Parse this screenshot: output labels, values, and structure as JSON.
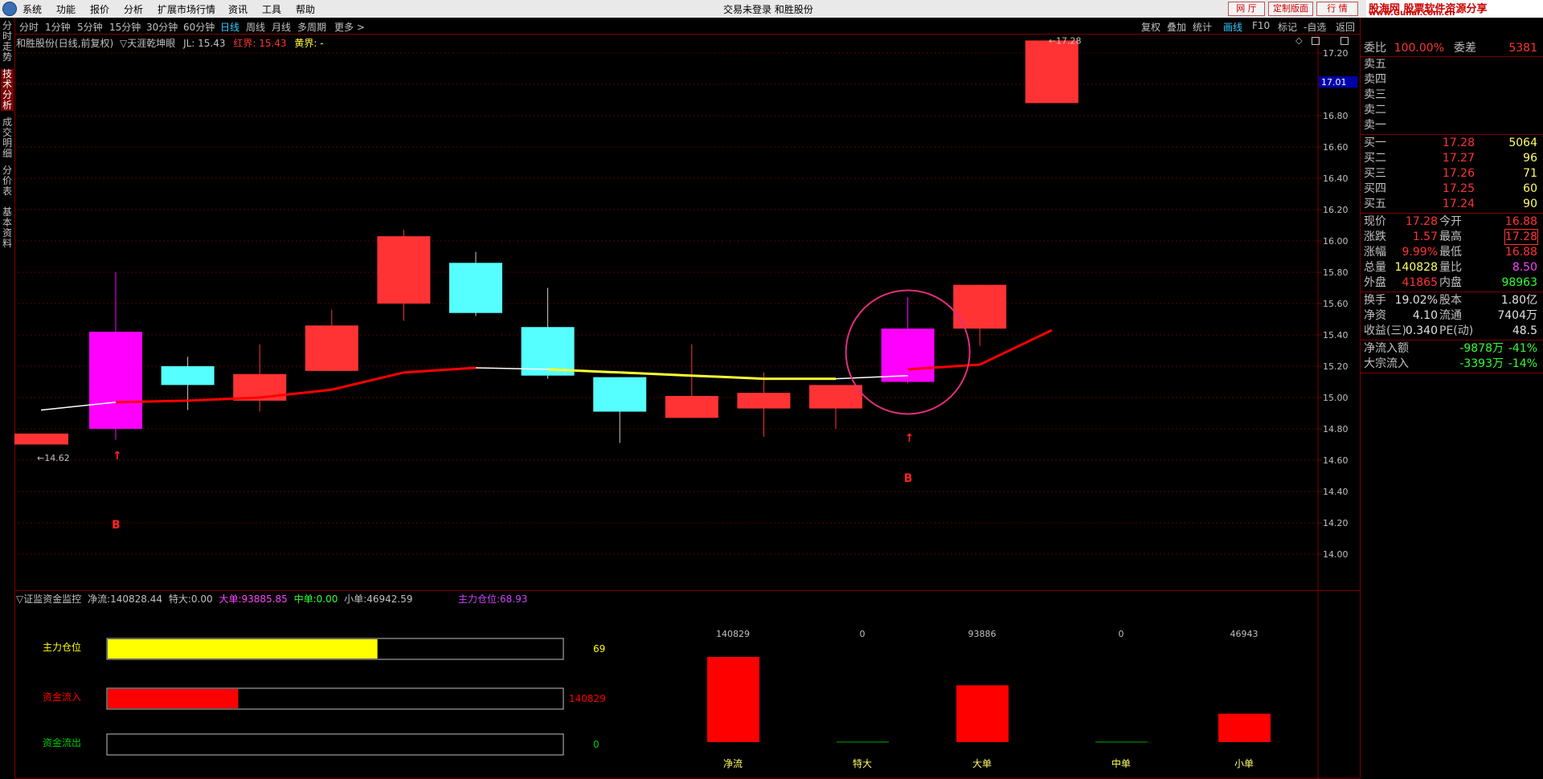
{
  "app": {
    "title_center": "交易未登录  和胜股份",
    "menu": [
      "系统",
      "功能",
      "报价",
      "分析",
      "扩展市场行情",
      "资讯",
      "工具",
      "帮助"
    ],
    "top_buttons": [
      "网 厅",
      "定制版面",
      "行 情"
    ],
    "site_logo": "股海网 股票软件资源分享",
    "site_url": "www.Guhai.com.cn"
  },
  "timeframes": [
    "分时",
    "1分钟",
    "5分钟",
    "15分钟",
    "30分钟",
    "60分钟",
    "日线",
    "周线",
    "月线",
    "多周期",
    "更多 >"
  ],
  "active_timeframe": "日线",
  "right_tools": [
    "复权",
    "叠加",
    "统计",
    "画线",
    "F10",
    "标记",
    "-自选",
    "返回"
  ],
  "active_tool": "画线",
  "left_tabs": [
    "分时走势",
    "技术分析",
    "成交明细",
    "分价表",
    "基本资料"
  ],
  "active_left_tab": "技术分析",
  "chart_header": {
    "stock": "和胜股份(日线,前复权)",
    "indicator": "▽天涯乾坤眼",
    "jl": "JL: 15.43",
    "red": "红界: 15.43",
    "yellow": "黄界: -"
  },
  "chart_data": {
    "type": "candlestick",
    "ylim": [
      13.8,
      17.35
    ],
    "y_ticks": [
      "17.20",
      "17.00",
      "16.80",
      "16.60",
      "16.40",
      "16.20",
      "16.00",
      "15.80",
      "15.60",
      "15.40",
      "15.20",
      "15.00",
      "14.80",
      "14.60",
      "14.40",
      "14.20",
      "14.00"
    ],
    "current_price_label": "17.01",
    "candles": [
      {
        "open": 14.77,
        "close": 14.7,
        "high": 14.7,
        "low": 14.7,
        "color": "red"
      },
      {
        "open": 14.8,
        "close": 15.42,
        "high": 15.8,
        "low": 14.73,
        "color": "magenta"
      },
      {
        "open": 15.2,
        "close": 15.08,
        "high": 15.26,
        "low": 14.92,
        "color": "cyan"
      },
      {
        "open": 14.98,
        "close": 15.15,
        "high": 15.34,
        "low": 14.91,
        "color": "red"
      },
      {
        "open": 15.17,
        "close": 15.46,
        "high": 15.56,
        "low": 15.17,
        "color": "red"
      },
      {
        "open": 15.6,
        "close": 16.03,
        "high": 16.07,
        "low": 15.49,
        "color": "red"
      },
      {
        "open": 15.86,
        "close": 15.54,
        "high": 15.93,
        "low": 15.52,
        "color": "cyan"
      },
      {
        "open": 15.45,
        "close": 15.14,
        "high": 15.7,
        "low": 15.12,
        "color": "cyan"
      },
      {
        "open": 15.13,
        "close": 14.91,
        "high": 15.13,
        "low": 14.71,
        "color": "cyan"
      },
      {
        "open": 14.87,
        "close": 15.01,
        "high": 15.34,
        "low": 14.87,
        "color": "red"
      },
      {
        "open": 14.93,
        "close": 15.03,
        "high": 15.16,
        "low": 14.75,
        "color": "red"
      },
      {
        "open": 14.93,
        "close": 15.08,
        "high": 15.08,
        "low": 14.8,
        "color": "red"
      },
      {
        "open": 15.1,
        "close": 15.44,
        "high": 15.64,
        "low": 15.09,
        "color": "magenta"
      },
      {
        "open": 15.44,
        "close": 15.72,
        "high": 15.72,
        "low": 15.33,
        "color": "red"
      },
      {
        "open": 16.88,
        "close": 17.28,
        "high": 17.28,
        "low": 16.88,
        "color": "red"
      }
    ],
    "line": [
      {
        "x": 0,
        "y": 14.92,
        "c": "white"
      },
      {
        "x": 1,
        "y": 14.97,
        "c": "white"
      },
      {
        "x": 1,
        "y": 14.97,
        "c": "red"
      },
      {
        "x": 2,
        "y": 14.98,
        "c": "red"
      },
      {
        "x": 3,
        "y": 15.0,
        "c": "red"
      },
      {
        "x": 4,
        "y": 15.05,
        "c": "red"
      },
      {
        "x": 5,
        "y": 15.16,
        "c": "red"
      },
      {
        "x": 6,
        "y": 15.19,
        "c": "red"
      },
      {
        "x": 6,
        "y": 15.19,
        "c": "white"
      },
      {
        "x": 7,
        "y": 15.18,
        "c": "white"
      },
      {
        "x": 7,
        "y": 15.18,
        "c": "yellow"
      },
      {
        "x": 8,
        "y": 15.16,
        "c": "yellow"
      },
      {
        "x": 9,
        "y": 15.14,
        "c": "yellow"
      },
      {
        "x": 10,
        "y": 15.12,
        "c": "yellow"
      },
      {
        "x": 11,
        "y": 15.12,
        "c": "yellow"
      },
      {
        "x": 11,
        "y": 15.12,
        "c": "white"
      },
      {
        "x": 12,
        "y": 15.14,
        "c": "white"
      },
      {
        "x": 12,
        "y": 15.18,
        "c": "red"
      },
      {
        "x": 13,
        "y": 15.21,
        "c": "red"
      },
      {
        "x": 14,
        "y": 15.43,
        "c": "red"
      }
    ],
    "annotations": {
      "low_label": "14.62",
      "high_label": "17.28",
      "buy_marks": [
        {
          "candle": 1,
          "label": "B"
        },
        {
          "candle": 12,
          "label": "B"
        }
      ]
    }
  },
  "bottom_panel": {
    "title": "▽证监资金监控",
    "items": [
      {
        "label": "净流:",
        "value": "140828.44"
      },
      {
        "label": "特大:",
        "value": "0.00"
      },
      {
        "label": "大单:",
        "value": "93885.85"
      },
      {
        "label": "中单:",
        "value": "0.00"
      },
      {
        "label": "小单:",
        "value": "46942.59"
      }
    ],
    "main_position_label": "主力仓位:",
    "main_position_value": "68.93",
    "hbars": [
      {
        "label": "主力仓位",
        "value": "69",
        "fraction": 0.593,
        "color": "#ffff00",
        "label_color": "#ffff00",
        "value_color": "#ffff00"
      },
      {
        "label": "资金流入",
        "value": "140829",
        "fraction": 0.287,
        "color": "#ff0000",
        "label_color": "#ff0000",
        "value_color": "#ff0000"
      },
      {
        "label": "资金流出",
        "value": "0",
        "fraction": 0,
        "color": "#00cc00",
        "label_color": "#00cc00",
        "value_color": "#00cc00"
      }
    ],
    "vbars": [
      {
        "label": "净流",
        "value": "140829",
        "amount": 140829
      },
      {
        "label": "特大",
        "value": "0",
        "amount": 0
      },
      {
        "label": "大单",
        "value": "93886",
        "amount": 93886
      },
      {
        "label": "中单",
        "value": "0",
        "amount": 0
      },
      {
        "label": "小单",
        "value": "46943",
        "amount": 46943
      }
    ]
  },
  "quote_panel": {
    "webi": {
      "label": "委比",
      "value": "100.00%",
      "label2": "委差",
      "value2": "5381"
    },
    "sells": [
      {
        "label": "卖五",
        "price": "",
        "vol": ""
      },
      {
        "label": "卖四",
        "price": "",
        "vol": ""
      },
      {
        "label": "卖三",
        "price": "",
        "vol": ""
      },
      {
        "label": "卖二",
        "price": "",
        "vol": ""
      },
      {
        "label": "卖一",
        "price": "",
        "vol": ""
      }
    ],
    "buys": [
      {
        "label": "买一",
        "price": "17.28",
        "vol": "5064"
      },
      {
        "label": "买二",
        "price": "17.27",
        "vol": "96"
      },
      {
        "label": "买三",
        "price": "17.26",
        "vol": "71"
      },
      {
        "label": "买四",
        "price": "17.25",
        "vol": "60"
      },
      {
        "label": "买五",
        "price": "17.24",
        "vol": "90"
      }
    ],
    "stats": [
      {
        "l1": "现价",
        "v1": "17.28",
        "c1": "#ff3333",
        "l2": "今开",
        "v2": "16.88",
        "c2": "#ff3333"
      },
      {
        "l1": "涨跌",
        "v1": "1.57",
        "c1": "#ff3333",
        "l2": "最高",
        "v2": "17.28",
        "c2": "#ff3333"
      },
      {
        "l1": "涨幅",
        "v1": "9.99%",
        "c1": "#ff3333",
        "l2": "最低",
        "v2": "16.88",
        "c2": "#ff3333"
      },
      {
        "l1": "总量",
        "v1": "140828",
        "c1": "#ffff66",
        "l2": "量比",
        "v2": "8.50",
        "c2": "#ff44ff"
      },
      {
        "l1": "外盘",
        "v1": "41865",
        "c1": "#ff3333",
        "l2": "内盘",
        "v2": "98963",
        "c2": "#33ff33"
      }
    ],
    "stats2": [
      {
        "l1": "换手",
        "v1": "19.02%",
        "l2": "股本",
        "v2": "1.80亿"
      },
      {
        "l1": "净资",
        "v1": "4.10",
        "l2": "流通",
        "v2": "7404万"
      },
      {
        "l1": "收益(三)",
        "v1": "0.340",
        "l2": "PE(动)",
        "v2": "48.5"
      }
    ],
    "flows": [
      {
        "label": "净流入额",
        "value": "-9878万",
        "pct": "-41%"
      },
      {
        "label": "大宗流入",
        "value": "-3393万",
        "pct": "-14%"
      }
    ]
  }
}
